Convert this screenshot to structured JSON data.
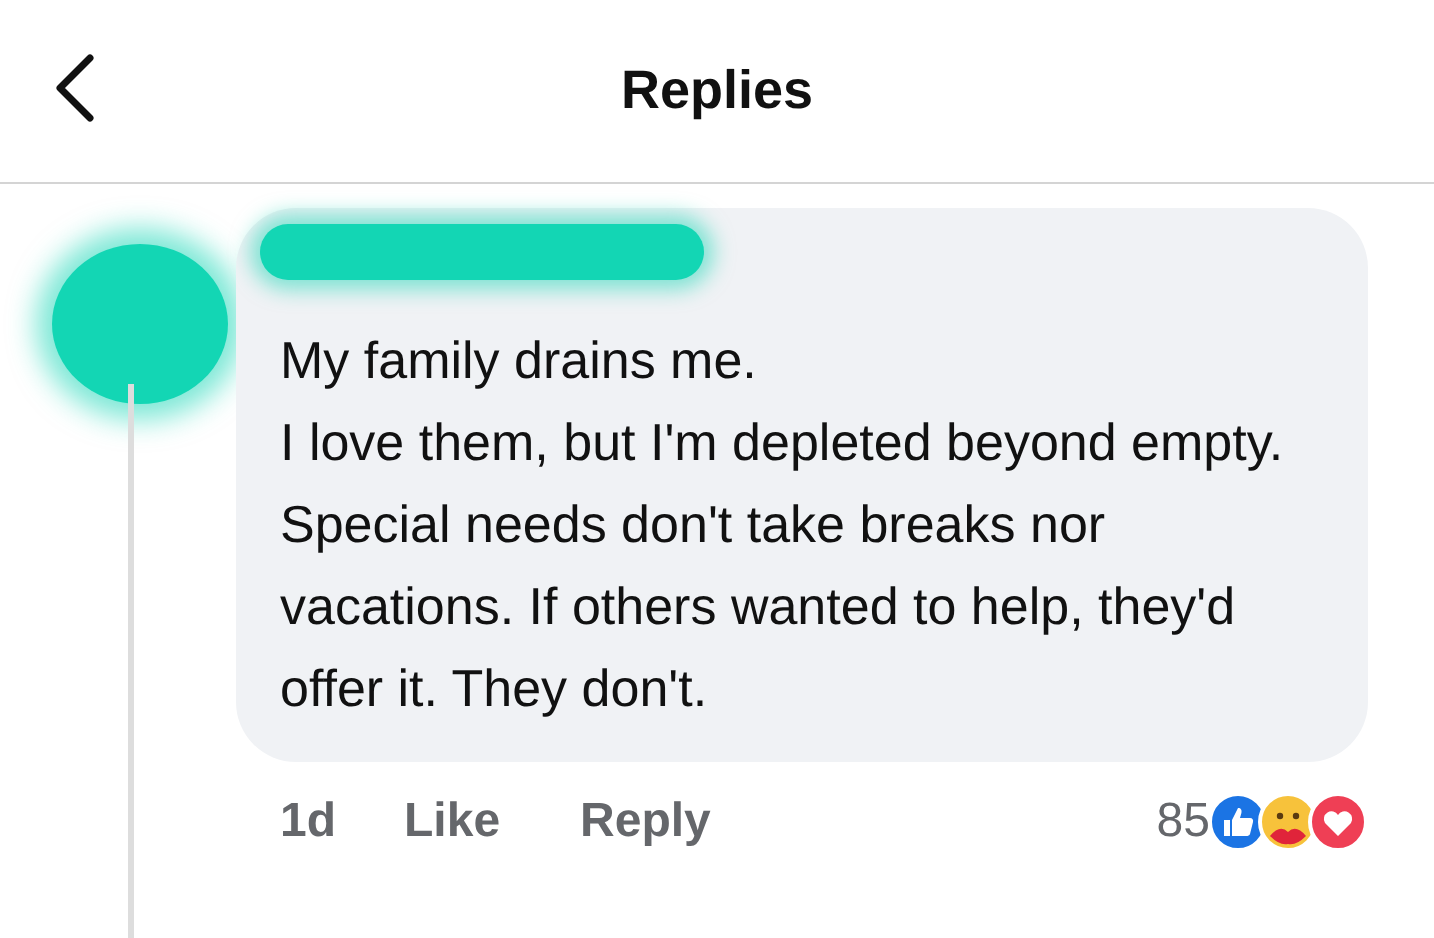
{
  "header": {
    "title": "Replies"
  },
  "comment": {
    "paragraphs": [
      "My family drains me.",
      "I love them, but I'm depleted beyond empty.",
      "Special needs don't take breaks nor vacations. If others wanted to help, they'd offer it. They don't."
    ],
    "time": "1d",
    "actions": [
      "Like",
      "Reply"
    ],
    "reaction_count": "85"
  }
}
